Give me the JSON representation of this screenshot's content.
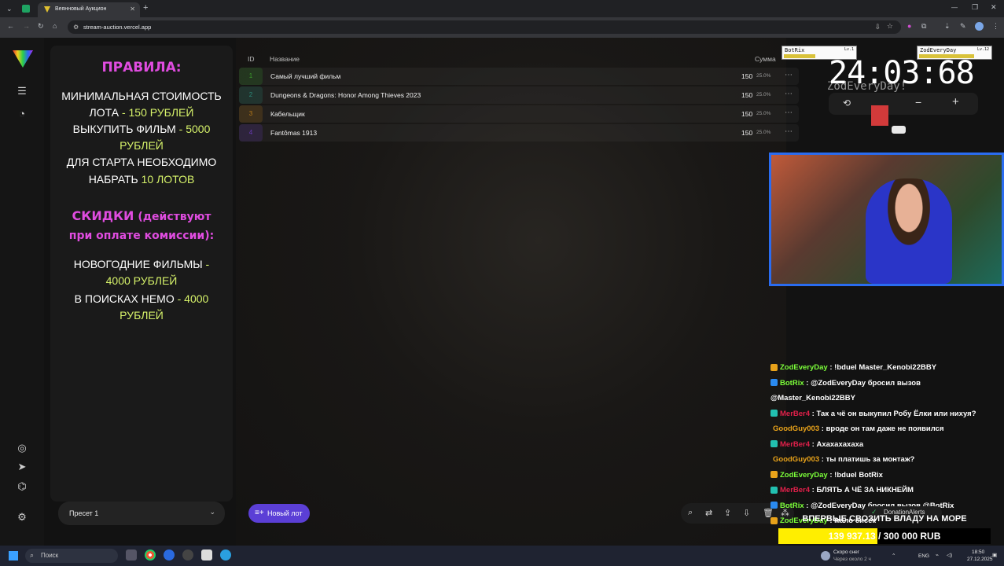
{
  "browser": {
    "tab_title": "Веянновый Аукцион",
    "url": "stream-auction.vercel.app"
  },
  "rules": {
    "heading": "ПРАВИЛА:",
    "line1": "МИНИМАЛЬНАЯ СТОИМОСТЬ",
    "line2a": "ЛОТА ",
    "line2b": "- 150 РУБЛЕЙ",
    "line3a": "ВЫКУПИТЬ ФИЛЬМ ",
    "line3b": "- 5000",
    "line4": "РУБЛЕЙ",
    "line5": "ДЛЯ СТАРТА НЕОБХОДИМО",
    "line6a": "НАБРАТЬ ",
    "line6b": "10 ЛОТОВ",
    "discount_heading": "СКИДКИ",
    "discount_note": " (действуют",
    "discount_line2": "при оплате комиссии):",
    "d1a": "НОВОГОДНИЕ ФИЛЬМЫ ",
    "d1b": "-",
    "d2": "4000 РУБЛЕЙ",
    "d3a": "В ПОИСКАХ НЕМО ",
    "d3b": "- 4000",
    "d4": "РУБЛЕЙ"
  },
  "preset": {
    "label": "Пресет 1"
  },
  "table": {
    "col_id": "ID",
    "col_name": "Название",
    "col_sum": "Сумма",
    "rows": [
      {
        "id": "1",
        "name": "Самый лучший фильм",
        "sum": "150",
        "pct": "25.0%",
        "color": "#3b9a2c"
      },
      {
        "id": "2",
        "name": "Dungeons & Dragons: Honor Among Thieves 2023",
        "sum": "150",
        "pct": "25.0%",
        "color": "#2c8a7a"
      },
      {
        "id": "3",
        "name": "Кабельщик",
        "sum": "150",
        "pct": "25.0%",
        "color": "#b87a1a"
      },
      {
        "id": "4",
        "name": "Fantômas 1913",
        "sum": "150",
        "pct": "25.0%",
        "color": "#6a3ab8"
      }
    ]
  },
  "new_lot": "Новый лот",
  "timer": {
    "value": "24:03:68",
    "minus": "−",
    "plus": "+"
  },
  "overlay": {
    "player1": "BotRix",
    "player1_level": "Lv.1",
    "player2": "ZodEveryDay",
    "player2_level": "Lv.12",
    "banner": "ZodEveryDay!"
  },
  "chat": [
    {
      "user": "ZodEveryDay",
      "color": "#7cff3a",
      "badge": "#e8a21a",
      "text": ": !bduel Master_Kenobi22BBY"
    },
    {
      "user": "BotRix",
      "color": "#7cff3a",
      "badge": "#2a8af0",
      "text": ": @ZodEveryDay бросил вызов @Master_Kenobi22BBY"
    },
    {
      "user": "MerBer4",
      "color": "#e0204a",
      "badge": "#22c0b0",
      "text": ": Так а чё он выкупил Робу Ёлки или нихуя?"
    },
    {
      "user": "GoodGuy003",
      "color": "#e8a21a",
      "badge": "",
      "text": ": вроде он там даже не появился"
    },
    {
      "user": "MerBer4",
      "color": "#e0204a",
      "badge": "#22c0b0",
      "text": ": Ахахахахаха"
    },
    {
      "user": "GoodGuy003",
      "color": "#e8a21a",
      "badge": "",
      "text": ": ты платишь за монтаж?"
    },
    {
      "user": "ZodEveryDay",
      "color": "#7cff3a",
      "badge": "#e8a21a",
      "text": ": !bduel BotRix"
    },
    {
      "user": "MerBer4",
      "color": "#e0204a",
      "badge": "#22c0b0",
      "text": ": БЛЯТЬ А ЧЁ ЗА НИКНЕЙМ"
    },
    {
      "user": "BotRix",
      "color": "#7cff3a",
      "badge": "#2a8af0",
      "text": ": @ZodEveryDay бросил вызов @BotRix"
    },
    {
      "user": "ZodEveryDay",
      "color": "#7cff3a",
      "badge": "#e8a21a",
      "text": ": мало сисек"
    }
  ],
  "donation": {
    "label": "DonationAlerts",
    "goal_title": "ВПЕРВЫЕ СВОЗИТЬ ВЛАДУ НА МОРЕ",
    "goal_current": "139 937.13",
    "goal_sep": " / ",
    "goal_total": "300 000 RUB",
    "goal_fraction": 0.4665
  },
  "taskbar": {
    "search": "Поиск",
    "weather_title": "Скоро снег",
    "weather_sub": "Через около 2 ч",
    "lang": "ENG",
    "time": "18:50",
    "date": "27.12.2025"
  }
}
